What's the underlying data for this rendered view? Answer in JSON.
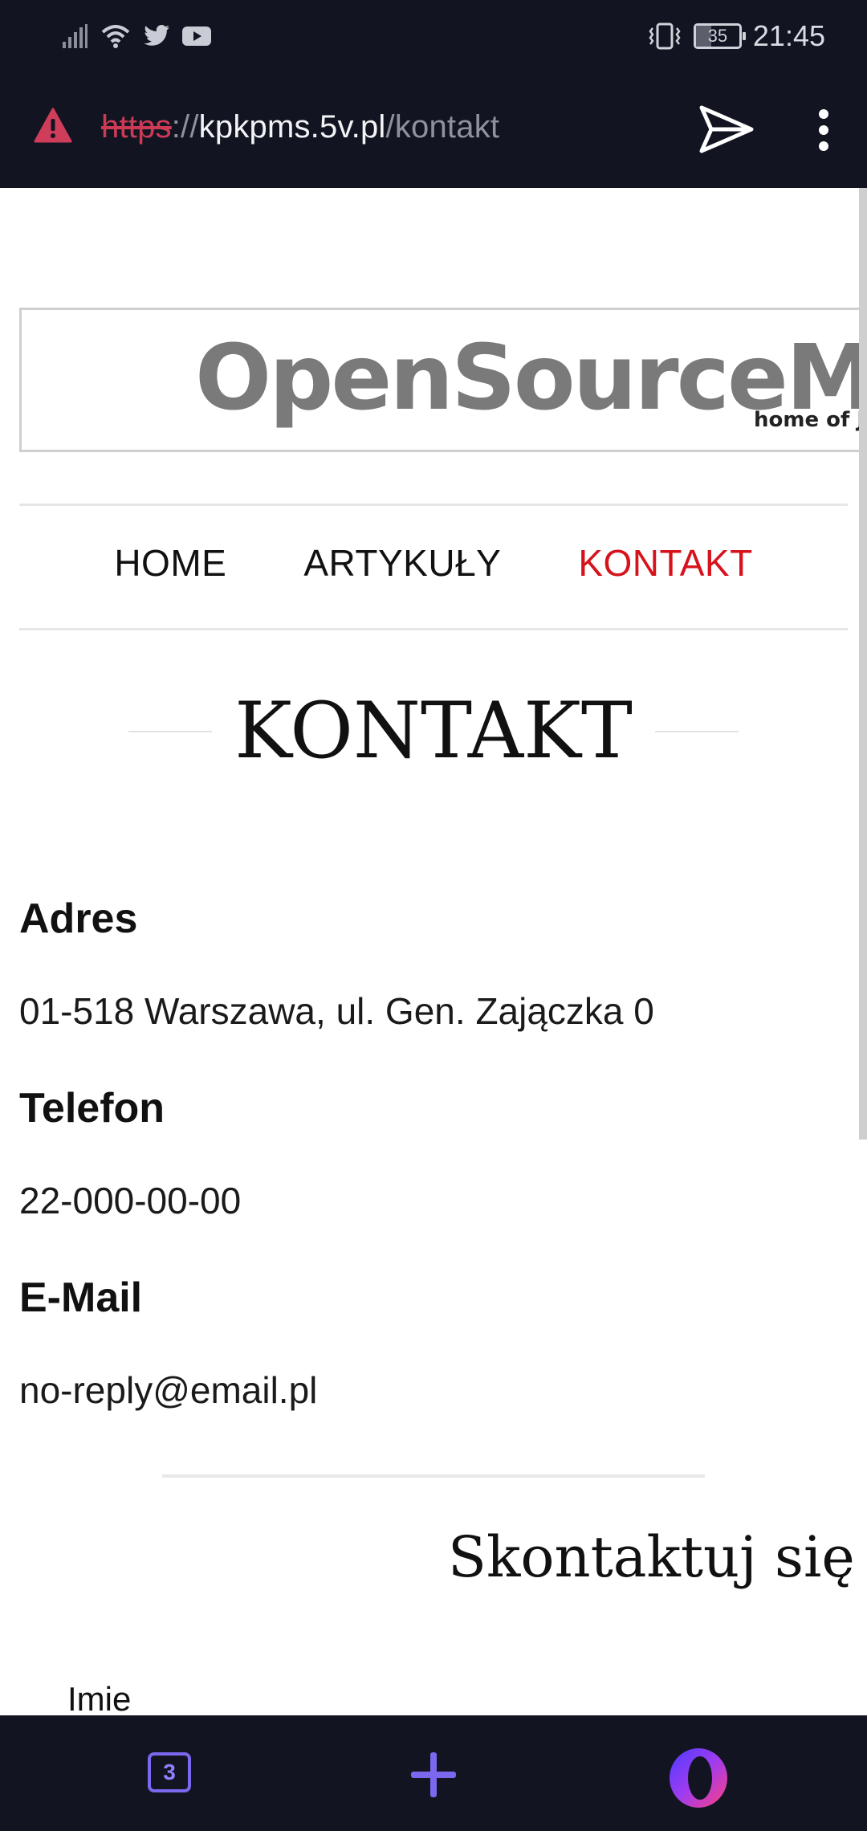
{
  "status_bar": {
    "icons": [
      "signal-icon",
      "wifi-icon",
      "twitter-icon",
      "youtube-icon"
    ],
    "vibrate_icon": "vibrate-icon",
    "battery_level": "35",
    "time": "21:45"
  },
  "address_bar": {
    "security_icon": "warning-icon",
    "url_scheme": "https",
    "url_separator": "://",
    "url_host": "kpkpms.5v.pl",
    "url_path": "/kontakt",
    "send_icon": "send-icon",
    "menu_icon": "more-vert-icon"
  },
  "logo": {
    "title": "OpenSourceMatte",
    "subtitle": "home of Jo"
  },
  "nav": {
    "items": [
      {
        "label": "HOME",
        "active": false
      },
      {
        "label": "ARTYKUŁY",
        "active": false
      },
      {
        "label": "KONTAKT",
        "active": true
      }
    ],
    "active_color": "#d6131d"
  },
  "page": {
    "title": "KONTAKT",
    "address_heading": "Adres",
    "address_value": "01-518 Warszawa, ul. Gen. Zajączka 0",
    "phone_heading": "Telefon",
    "phone_value": "22-000-00-00",
    "email_heading": "E-Mail",
    "email_value": "no-reply@email.pl",
    "contact_form_title": "Skontaktuj się z",
    "first_field_label": "Imie"
  },
  "bottom_bar": {
    "tab_count": "3",
    "new_tab_icon": "plus-icon",
    "opera_icon": "opera-logo-icon",
    "accent": "#7b68ee"
  }
}
